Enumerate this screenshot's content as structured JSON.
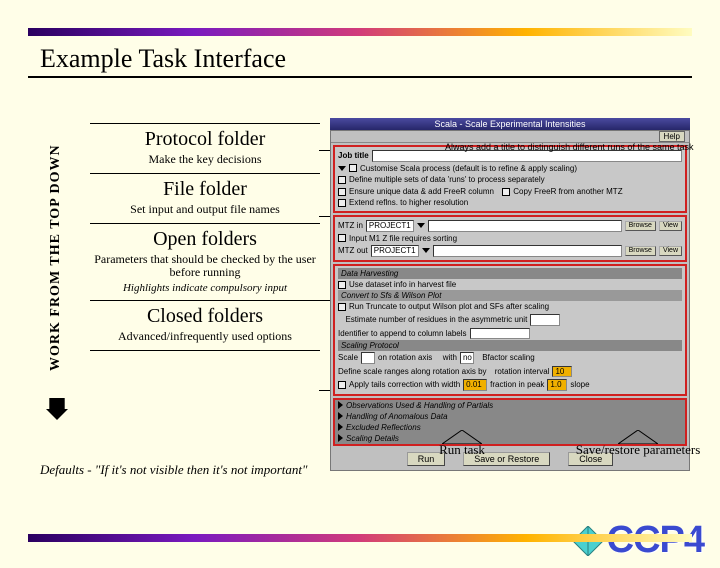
{
  "title": "Example Task Interface",
  "vertical_label": "WORK FROM THE TOP DOWN",
  "folders": [
    {
      "title": "Protocol folder",
      "sub": "Make the key decisions",
      "note": ""
    },
    {
      "title": "File folder",
      "sub": "Set input and output file names",
      "note": ""
    },
    {
      "title": "Open folders",
      "sub": "Parameters that should be checked by the user before running",
      "note": "Highlights indicate compulsory input"
    },
    {
      "title": "Closed folders",
      "sub": "Advanced/infrequently used options",
      "note": ""
    }
  ],
  "defaults_note": "Defaults - \"If it's not visible then it's not important\"",
  "annotations": {
    "run": "Run task",
    "save": "Save/restore parameters"
  },
  "logo": "CCP4",
  "ui": {
    "window_title": "Scala - Scale Experimental Intensities",
    "help": "Help",
    "callout": "Always add a title to distinguish different runs of the same task",
    "job_title_label": "Job title",
    "protocol_rows": [
      "Customise Scala process (default is to refine & apply scaling)",
      "Define multiple sets of data 'runs' to process separately",
      "Ensure unique data & add FreeR column",
      "Extend reflns. to higher resolution"
    ],
    "copy": "Copy FreeR from another MTZ",
    "file_rows": [
      {
        "lab": "MTZ in",
        "proj": "PROJECT1",
        "b1": "Browse",
        "b2": "View"
      },
      {
        "lab": "Input M1 Z file requires sorting"
      },
      {
        "lab": "MTZ out",
        "proj": "PROJECT1",
        "b1": "Browse",
        "b2": "View"
      }
    ],
    "open_headers": [
      "Data Harvesting",
      "Scaling Protocol",
      "Observations Used  &  Handling of Partials",
      "Handling of Anomalous Data",
      "Excluded Reflections",
      "Scaling Details"
    ],
    "open_lines": {
      "harvest": "Use dataset info in harvest file",
      "convert": "Convert to Sfs & Wilson Plot",
      "truncate": "Run Truncate to output Wilson plot and SFs after scaling",
      "estimate": "Estimate number of residues in the asymmetric unit",
      "identity": "Identifier to append to column labels",
      "scale": "Scale",
      "rotation": "on rotation axis",
      "with": "with",
      "bfactor": "Bfactor scaling",
      "runcorr": "Define scale ranges along rotation axis by",
      "rotint": "rotation interval",
      "rotval": "10",
      "tails": "Apply tails correction with width",
      "tv1": "0.01",
      "frac": "fraction in peak",
      "tv2": "1.0",
      "slope": "slope"
    },
    "buttons": {
      "run": "Run",
      "save": "Save or Restore",
      "close": "Close"
    }
  }
}
